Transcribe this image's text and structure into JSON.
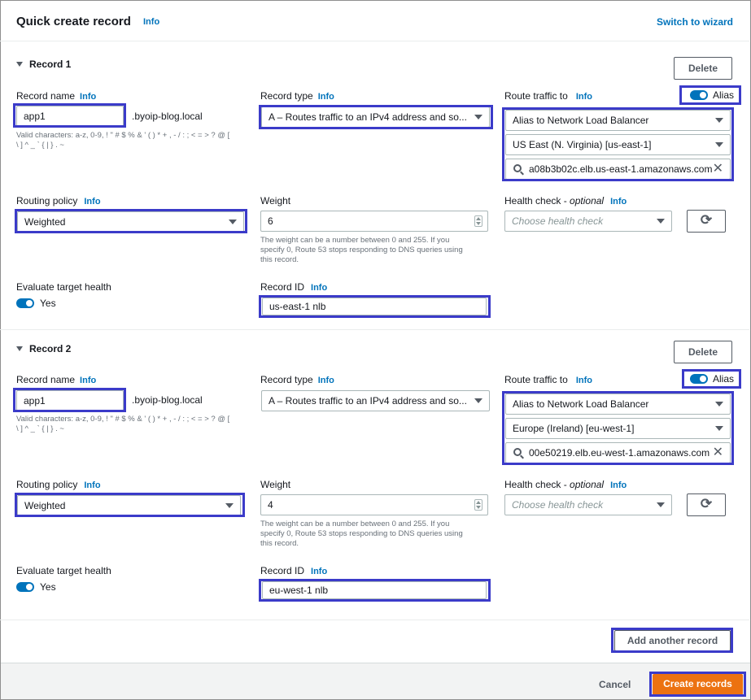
{
  "header": {
    "title": "Quick create record",
    "info": "Info",
    "switch_wizard": "Switch to wizard"
  },
  "labels": {
    "record_name": "Record name",
    "record_type": "Record type",
    "route_traffic": "Route traffic to",
    "alias": "Alias",
    "routing_policy": "Routing policy",
    "weight": "Weight",
    "health_check": "Health check - ",
    "optional": "optional",
    "evaluate_target_health": "Evaluate target health",
    "yes": "Yes",
    "record_id": "Record ID",
    "info": "Info",
    "delete": "Delete"
  },
  "records": [
    {
      "title": "Record 1",
      "record_name": "app1",
      "domain_suffix": ".byoip-blog.local",
      "valid_chars_line1": "Valid characters: a-z, 0-9, ! \" # $ % & ' ( ) * + , - / : ; < = > ? @ [",
      "valid_chars_line2": "\\ ] ^ _ ` { | } . ~",
      "record_type": "A – Routes traffic to an IPv4 address and so...",
      "route_target": "Alias to Network Load Balancer",
      "region": "US East (N. Virginia) [us-east-1]",
      "endpoint": "a08b3b02c.elb.us-east-1.amazonaws.com",
      "routing_policy": "Weighted",
      "weight": "6",
      "weight_hint_1": "The weight can be a number between 0 and 255. If you",
      "weight_hint_2": "specify 0, Route 53 stops responding to DNS queries using",
      "weight_hint_3": "this record.",
      "health_check_placeholder": "Choose health check",
      "record_id": "us-east-1 nlb"
    },
    {
      "title": "Record 2",
      "record_name": "app1",
      "domain_suffix": ".byoip-blog.local",
      "valid_chars_line1": "Valid characters: a-z, 0-9, ! \" # $ % & ' ( ) * + , - / : ; < = > ? @ [",
      "valid_chars_line2": "\\ ] ^ _ ` { | } . ~",
      "record_type": "A – Routes traffic to an IPv4 address and so...",
      "route_target": "Alias to Network Load Balancer",
      "region": "Europe (Ireland) [eu-west-1]",
      "endpoint": "00e50219.elb.eu-west-1.amazonaws.com",
      "routing_policy": "Weighted",
      "weight": "4",
      "weight_hint_1": "The weight can be a number between 0 and 255. If you",
      "weight_hint_2": "specify 0, Route 53 stops responding to DNS queries using",
      "weight_hint_3": "this record.",
      "health_check_placeholder": "Choose health check",
      "record_id": "eu-west-1 nlb"
    }
  ],
  "actions": {
    "add_another": "Add another record",
    "cancel": "Cancel",
    "create": "Create records"
  },
  "colors": {
    "accent": "#0073bb",
    "highlight": "#3b3bc9",
    "primary_button": "#ec7211"
  }
}
